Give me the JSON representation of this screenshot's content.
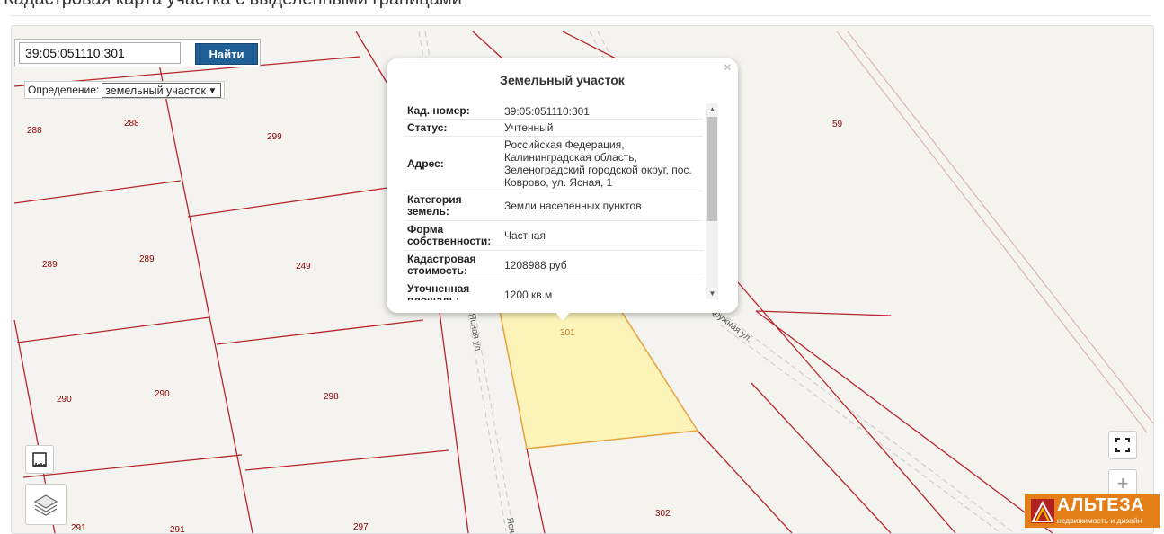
{
  "page": {
    "title": "Кадастровая карта участка с выделенными границами"
  },
  "search": {
    "value": "39:05:051110:301",
    "button_label": "Найти"
  },
  "definition": {
    "label": "Определение:",
    "selected": "земельный участок"
  },
  "popup": {
    "title": "Земельный участок",
    "close": "×",
    "rows": [
      {
        "label": "Кад. номер:",
        "value": "39:05:051110:301"
      },
      {
        "label": "Статус:",
        "value": "Учтенный"
      },
      {
        "label": "Адрес:",
        "value": "Российская Федерация, Калининградская область, Зеленоградский городской округ, пос. Коврово, ул. Ясная, 1"
      },
      {
        "label": "Категория земель:",
        "value": "Земли населенных пунктов"
      },
      {
        "label": "Форма собственности:",
        "value": "Частная"
      },
      {
        "label": "Кадастровая стоимость:",
        "value": "1208988 руб"
      },
      {
        "label": "Уточненная площадь:",
        "value": "1200 кв.м"
      }
    ]
  },
  "map": {
    "plot_labels": [
      "288",
      "288",
      "299",
      "59",
      "289",
      "289",
      "249",
      "290",
      "290",
      "298",
      "301",
      "302",
      "291",
      "291",
      "297"
    ],
    "street_labels": [
      "Ясная ул.",
      "Ясная ул.",
      "Дружная ул."
    ],
    "colors": {
      "boundary": "#b8262b",
      "selected_fill": "#fbf3b7",
      "selected_stroke": "#e8a23c",
      "road": "#bfbfbf"
    }
  },
  "controls": {
    "fullscreen_icon": "fullscreen-icon",
    "zoom_in": "+",
    "ruler_icon": "ruler-icon",
    "layers_icon": "layers-icon"
  },
  "logo": {
    "name": "АЛЬТЕЗА",
    "slogan": "недвижимость и дизайн"
  },
  "icons": {
    "close": "close-icon",
    "scroll_up": "chevron-up-icon",
    "scroll_down": "chevron-down-icon",
    "select_arrow": "chevron-down-icon"
  }
}
